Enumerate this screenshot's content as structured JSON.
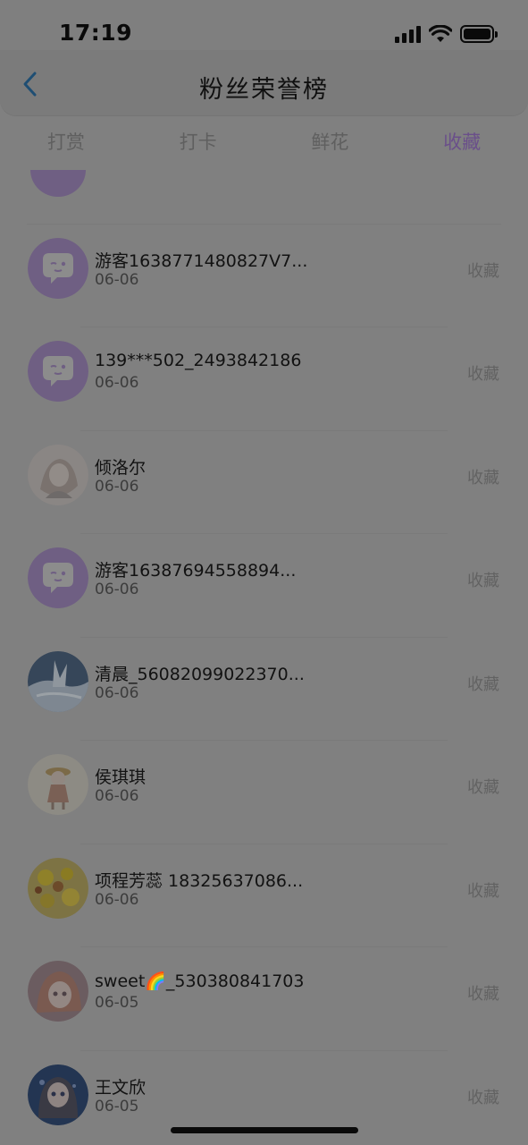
{
  "status": {
    "time": "17:19"
  },
  "header": {
    "title": "粉丝荣誉榜",
    "back_icon": "chevron-left-icon"
  },
  "tabs": [
    {
      "label": "打赏",
      "active": false
    },
    {
      "label": "打卡",
      "active": false
    },
    {
      "label": "鲜花",
      "active": false
    },
    {
      "label": "收藏",
      "active": true
    }
  ],
  "fans": [
    {
      "name": "游客1638771480827V7...",
      "date": "06-06",
      "action": "收藏",
      "avatar": "default-chat-avatar"
    },
    {
      "name": "139***502_2493842186",
      "date": "06-06",
      "action": "收藏",
      "avatar": "default-chat-avatar"
    },
    {
      "name": "倾洛尔",
      "date": "06-06",
      "action": "收藏",
      "avatar": "anime-girl-sketch-avatar"
    },
    {
      "name": "游客16387694558894...",
      "date": "06-06",
      "action": "收藏",
      "avatar": "default-chat-avatar"
    },
    {
      "name": "清晨_56082099022370...",
      "date": "06-06",
      "action": "收藏",
      "avatar": "winter-tree-avatar"
    },
    {
      "name": "侯琪琪",
      "date": "06-06",
      "action": "收藏",
      "avatar": "girl-with-hat-avatar"
    },
    {
      "name": "项程芳蕊 18325637086...",
      "date": "06-06",
      "action": "收藏",
      "avatar": "yellow-flowers-avatar"
    },
    {
      "name": "sweet🌈_530380841703",
      "date": "06-05",
      "action": "收藏",
      "avatar": "anime-girl-pink-avatar"
    },
    {
      "name": "王文欣",
      "date": "06-05",
      "action": "收藏",
      "avatar": "anime-girl-blue-avatar"
    }
  ],
  "colors": {
    "accent": "#6a4f8a",
    "default_avatar": "#6f5f83"
  }
}
